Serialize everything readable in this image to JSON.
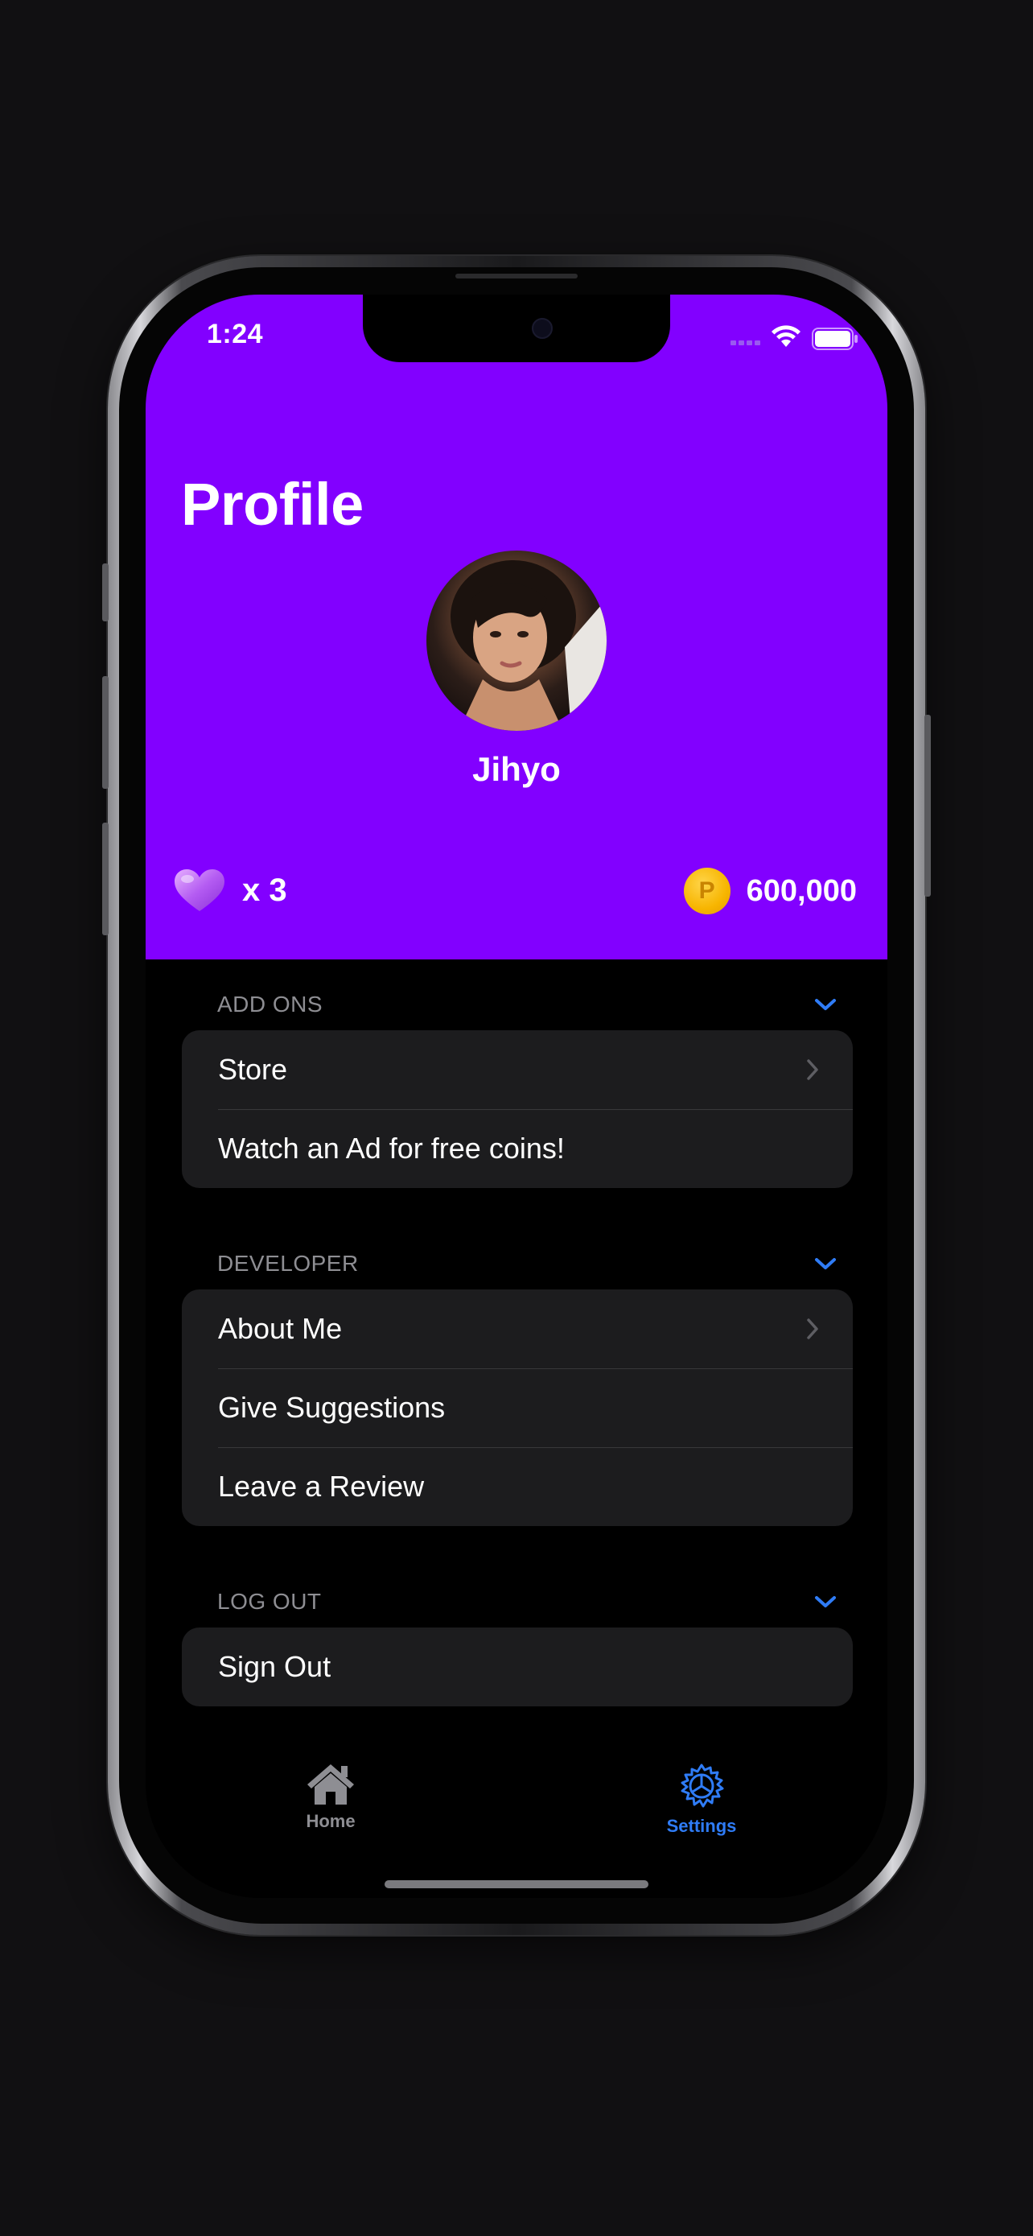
{
  "status_bar": {
    "time": "1:24"
  },
  "header": {
    "title": "Profile",
    "user_name": "Jihyo",
    "lives_label": "x  3",
    "coin_symbol": "P",
    "coins": "600,000"
  },
  "sections": [
    {
      "title": "ADD ONS",
      "rows": [
        {
          "label": "Store"
        },
        {
          "label": "Watch an Ad for free coins!"
        }
      ]
    },
    {
      "title": "DEVELOPER",
      "rows": [
        {
          "label": "About Me"
        },
        {
          "label": "Give Suggestions"
        },
        {
          "label": "Leave a Review"
        }
      ]
    },
    {
      "title": "LOG OUT",
      "rows": [
        {
          "label": "Sign Out"
        }
      ]
    }
  ],
  "tab_bar": {
    "home_label": "Home",
    "settings_label": "Settings",
    "active_tab": "Settings"
  },
  "colors": {
    "header_bg": "#8200ff",
    "accent": "#2f7cf6",
    "inactive": "#8e8e93",
    "cell_bg": "#1c1c1e",
    "coin": "#f7b500"
  },
  "icons": [
    "wifi-icon",
    "battery-icon",
    "heart-icon",
    "coin-icon",
    "chevron-down-icon",
    "chevron-right-icon",
    "home-icon",
    "gear-icon"
  ]
}
